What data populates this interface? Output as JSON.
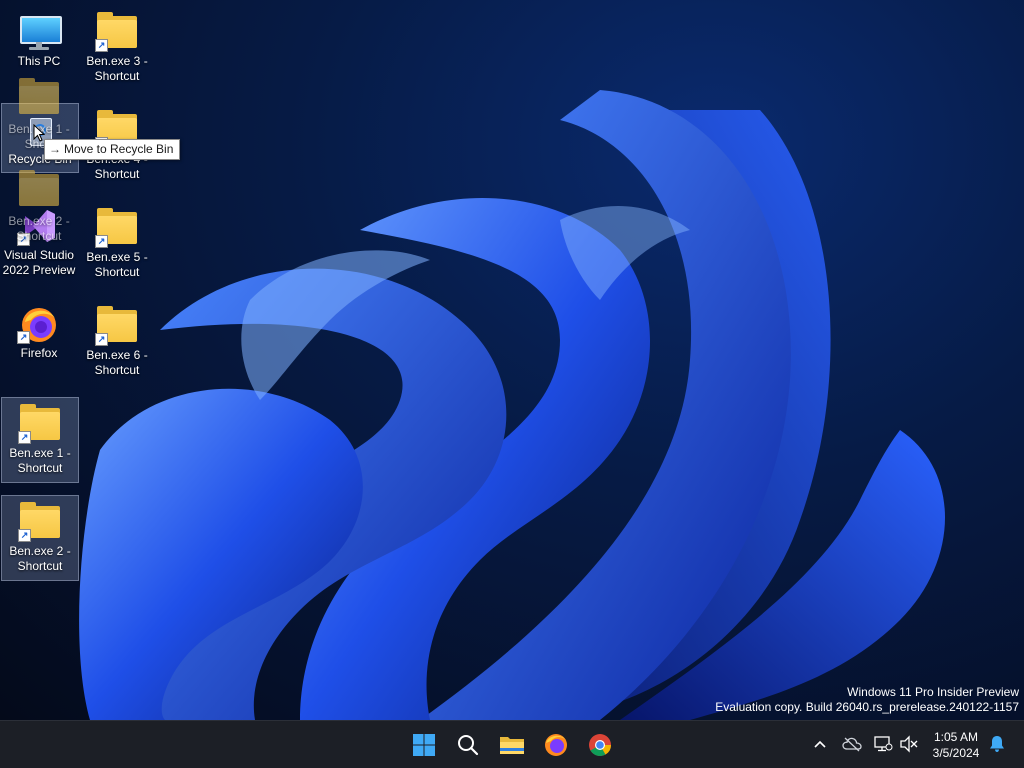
{
  "desktop": {
    "icons": [
      {
        "id": "this-pc",
        "label": "This PC"
      },
      {
        "id": "ben3",
        "label": "Ben.exe 3 - Shortcut"
      },
      {
        "id": "recycle-bin",
        "label": "Recycle Bin"
      },
      {
        "id": "ben4",
        "label": "Ben.exe 4 - Shortcut"
      },
      {
        "id": "vs2022",
        "label": "Visual Studio 2022 Preview"
      },
      {
        "id": "ben5",
        "label": "Ben.exe 5 - Shortcut"
      },
      {
        "id": "firefox",
        "label": "Firefox"
      },
      {
        "id": "ben6",
        "label": "Ben.exe 6 - Shortcut"
      },
      {
        "id": "ben1",
        "label": "Ben.exe 1 - Shortcut"
      },
      {
        "id": "ben2",
        "label": "Ben.exe 2 - Shortcut"
      }
    ],
    "drag_ghost_labels": [
      "Ben.exe 1 - Short",
      "Ben.exe 2 - Shortcut"
    ],
    "tooltip": {
      "text": "Move to Recycle Bin",
      "icon": "arrow-right-icon"
    }
  },
  "watermark": {
    "line1": "Windows 11 Pro Insider Preview",
    "line2": "Evaluation copy. Build 26040.rs_prerelease.240122-1157"
  },
  "taskbar": {
    "apps": [
      {
        "name": "start",
        "icon": "windows-logo-icon"
      },
      {
        "name": "search",
        "icon": "search-icon"
      },
      {
        "name": "file-explorer",
        "icon": "folder-icon"
      },
      {
        "name": "firefox",
        "icon": "firefox-icon"
      },
      {
        "name": "chrome",
        "icon": "chrome-icon"
      }
    ],
    "tray": {
      "icons": [
        "chevron-up-icon",
        "cloud-offline-icon",
        "network-icon",
        "volume-muted-icon"
      ],
      "time": "1:05 AM",
      "date": "3/5/2024",
      "notification_icon": "bell-icon"
    }
  },
  "colors": {
    "accent": "#1e5cff",
    "taskbar_bg": "#1c1f26",
    "folder": "#f6c744",
    "selection": "#c8dcff"
  }
}
